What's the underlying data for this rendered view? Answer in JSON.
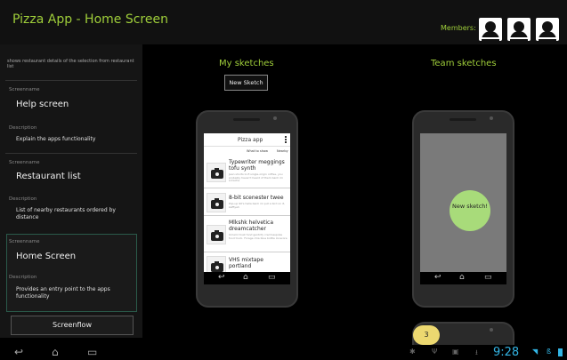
{
  "header": {
    "title": "Pizza App - Home Screen",
    "members_label": "Members:"
  },
  "left_panel": {
    "top_description": "shows restaurant details of the selection from restaurant list",
    "entries": [
      {
        "screenname_label": "Screenname",
        "title": "Help screen",
        "description_label": "Description",
        "description": "Explain the apps functionality"
      },
      {
        "screenname_label": "Screenname",
        "title": "Restaurant list",
        "description_label": "Description",
        "description": "List of nearby restaurants ordered by distance"
      },
      {
        "screenname_label": "Screenname",
        "title": "Home Screen",
        "description_label": "Description",
        "description": "Provides an entry point to the apps functionality"
      }
    ],
    "screenflow_label": "Screenflow"
  },
  "my_sketches": {
    "title": "My sketches",
    "new_sketch_label": "New Sketch",
    "screen": {
      "title": "Pizza app",
      "tab_left": "What to show",
      "tab_right": "Nearby",
      "items": [
        {
          "title": "Typewriter meggings tofu synth",
          "sub": "Jean shorts lo-fi single-origin coffee, you probably haven't heard of them banh mi sriracha"
        },
        {
          "title": "8-bit scenester twee",
          "sub": "Pop-up 90's hella banh mi put a bird on it, keffiyeh"
        },
        {
          "title": "Mlkshk helvetica dreamcatcher",
          "sub": "Umami trust fund gentrify cred bespoke food truck. Forage chia blue bottle locavore"
        },
        {
          "title": "VHS mixtape portland",
          "sub": ""
        }
      ]
    }
  },
  "team_sketches": {
    "title": "Team sketches",
    "new_sketch_circle": "New sketch!"
  },
  "badge": {
    "count": "3"
  },
  "system_bar": {
    "time": "9:28"
  }
}
